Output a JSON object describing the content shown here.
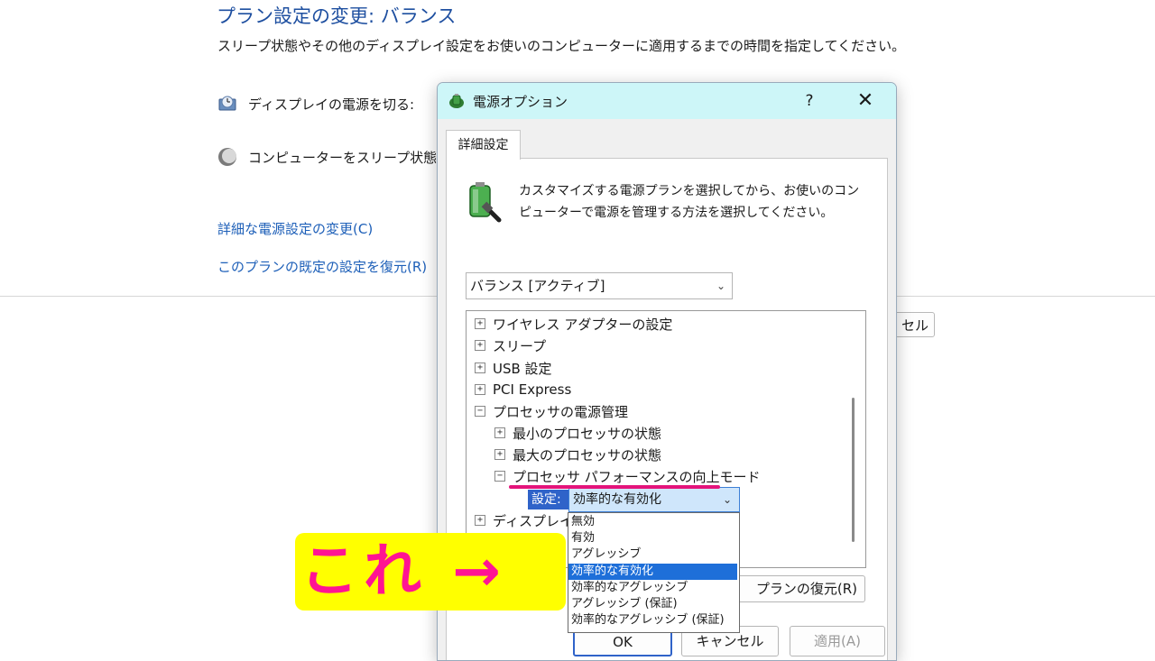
{
  "background": {
    "title": "プラン設定の変更: バランス",
    "description": "スリープ状態やその他のディスプレイ設定をお使いのコンピューターに適用するまでの時間を指定してください。",
    "display_off_label": "ディスプレイの電源を切る:",
    "sleep_label": "コンピューターをスリープ状態にする",
    "advanced_link": "詳細な電源設定の変更(C)",
    "restore_link": "このプランの既定の設定を復元(R)",
    "cancel_partial": "セル"
  },
  "dialog": {
    "title": "電源オプション",
    "help": "?",
    "close": "✕",
    "tab": "詳細設定",
    "instructions": "カスタマイズする電源プランを選択してから、お使いのコンピューターで電源を管理する方法を選択してください。",
    "plan_select": "バランス [アクティブ]",
    "tree": [
      {
        "sign": "+",
        "label": "ワイヤレス アダプターの設定"
      },
      {
        "sign": "+",
        "label": "スリープ"
      },
      {
        "sign": "+",
        "label": "USB 設定"
      },
      {
        "sign": "+",
        "label": "PCI Express"
      },
      {
        "sign": "−",
        "label": "プロセッサの電源管理"
      },
      {
        "sign": "+",
        "label": "最小のプロセッサの状態"
      },
      {
        "sign": "+",
        "label": "最大のプロセッサの状態"
      },
      {
        "sign": "−",
        "label": "プロセッサ パフォーマンスの向上モード"
      },
      {
        "sign": "+",
        "label": "ディスプレイ"
      }
    ],
    "setting_label": "設定:",
    "setting_value": "効率的な有効化",
    "options": [
      "無効",
      "有効",
      "アグレッシブ",
      "効率的な有効化",
      "効率的なアグレッシブ",
      "アグレッシブ (保証)",
      "効率的なアグレッシブ (保証)"
    ],
    "selected_option": "効率的な有効化",
    "restore_button": "プランの復元(R)",
    "ok": "OK",
    "cancel": "キャンセル",
    "apply": "適用(A)"
  },
  "annotation": {
    "callout": "これ →",
    "underline_color": "#e4147b",
    "callout_bg": "#ffff00",
    "callout_color": "#ff1493"
  },
  "colors": {
    "titlebar": "#cdf6f8",
    "link": "#1d5fb8",
    "selection": "#1e6fd9"
  }
}
